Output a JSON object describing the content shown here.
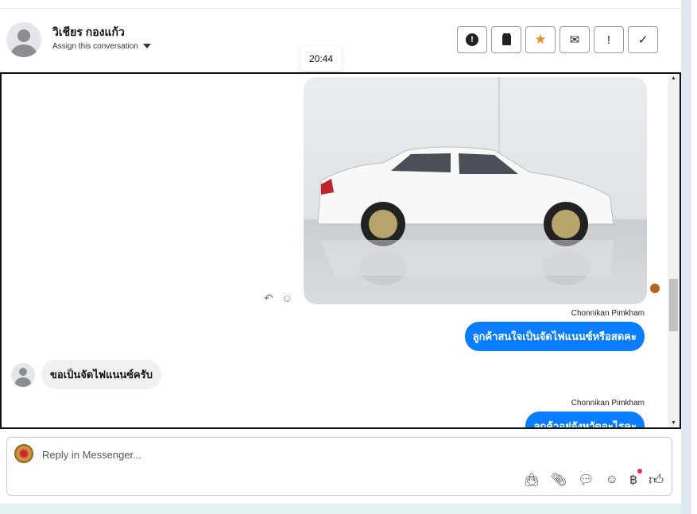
{
  "header": {
    "contact_name": "วิเชียร กองแก้ว",
    "assign_label": "Assign this conversation",
    "actions": [
      {
        "icon": "alert-circle-icon",
        "glyph": "❗"
      },
      {
        "icon": "trash-icon",
        "glyph": "🗑"
      },
      {
        "icon": "star-icon",
        "glyph": "★"
      },
      {
        "icon": "mail-icon",
        "glyph": "✉"
      },
      {
        "icon": "exclamation-icon",
        "glyph": "!"
      },
      {
        "icon": "check-icon",
        "glyph": "✓"
      }
    ]
  },
  "tooltip_time": "20:44",
  "messages": [
    {
      "sender": "Chonnikan Pimkham",
      "text": "ลูกค้าสนใจเป็นจัดไฟแนนซ์หรือสดคะ"
    },
    {
      "text": "ขอเป็นจัดไฟแนนซ์ครับ"
    },
    {
      "sender": "Chonnikan Pimkham",
      "text": "ลูกค้าอยู่จังหวัดอะไรคะ"
    }
  ],
  "composer": {
    "placeholder": "Reply in Messenger...",
    "baht": "฿"
  },
  "colors": {
    "accent": "#0a7cff",
    "star": "#f08a24"
  }
}
